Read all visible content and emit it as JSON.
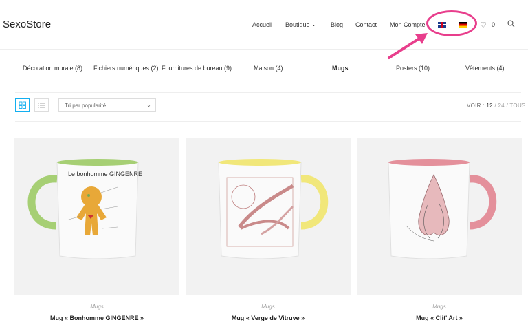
{
  "header": {
    "logo": "SexoStore",
    "nav": [
      "Accueil",
      "Boutique",
      "Blog",
      "Contact",
      "Mon Compte"
    ],
    "languages": [
      "english-flag",
      "german-flag"
    ],
    "wishlist_count": "0"
  },
  "categories": [
    "Décoration murale (8)",
    "Fichiers numériques (2)",
    "Fournitures de bureau (9)",
    "Maison (4)",
    "Mugs",
    "Posters (10)",
    "Vêtements (4)"
  ],
  "toolbar": {
    "sort_selected": "Tri par popularité",
    "voir_label": "VOIR :",
    "per_page": [
      "12",
      "24",
      "TOUS"
    ]
  },
  "products": [
    {
      "category": "Mugs",
      "name": "Mug « Bonhomme GINGENRE »",
      "mug_title": "Le bonhomme GINGENRE",
      "accent": "#a6cf74"
    },
    {
      "category": "Mugs",
      "name": "Mug « Verge de Vitruve »",
      "accent": "#f1e77a"
    },
    {
      "category": "Mugs",
      "name": "Mug « Clit' Art »",
      "accent": "#e4909b"
    }
  ],
  "colors": {
    "accent": "#13aff0",
    "annotation": "#e83e8c"
  }
}
